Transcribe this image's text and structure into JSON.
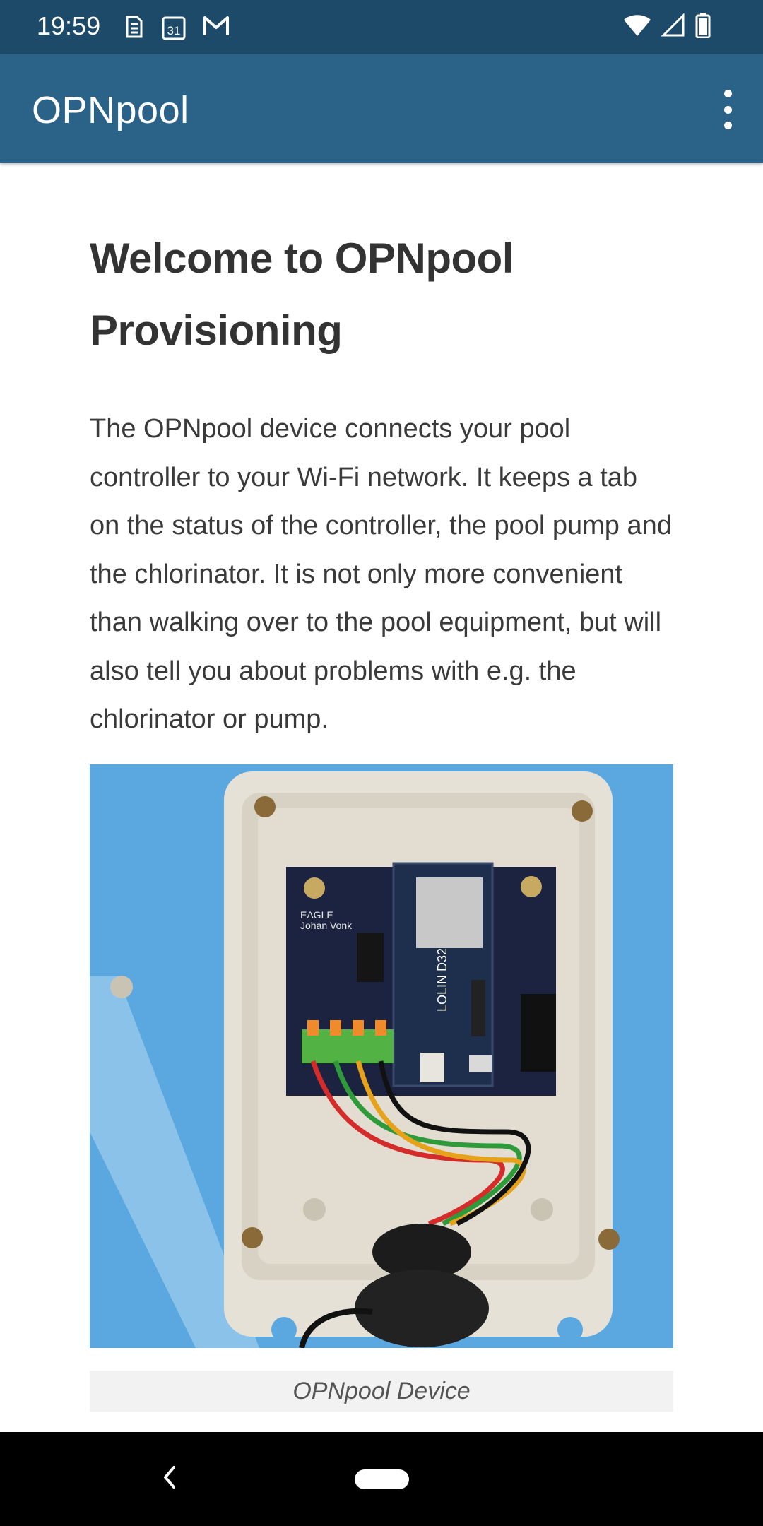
{
  "status_bar": {
    "time": "19:59",
    "icons": [
      "sim-icon",
      "calendar-icon",
      "gmail-icon",
      "wifi-icon",
      "signal-icon",
      "battery-icon"
    ],
    "calendar_day": "31"
  },
  "app_bar": {
    "title": "OPNpool",
    "menu_icon": "more-vert-icon"
  },
  "content": {
    "heading": "Welcome to OPNpool Provisioning",
    "intro": "The OPNpool device connects your pool controller to your Wi-Fi network. It keeps a tab on the status of the controller, the pool pump and the chlorinator. It is not only more convenient than walking over to the pool equipment, but will also tell you about problems with e.g. the chlorinator or pump.",
    "figure": {
      "image_label": "photo of OPNpool device board in enclosure",
      "board_text": [
        "EAGLE",
        "Johan Vonk",
        "LOLIN D32"
      ],
      "caption": "OPNpool Device"
    }
  },
  "nav_bar": {
    "back_icon": "back-icon",
    "home_icon": "home-pill-icon"
  }
}
